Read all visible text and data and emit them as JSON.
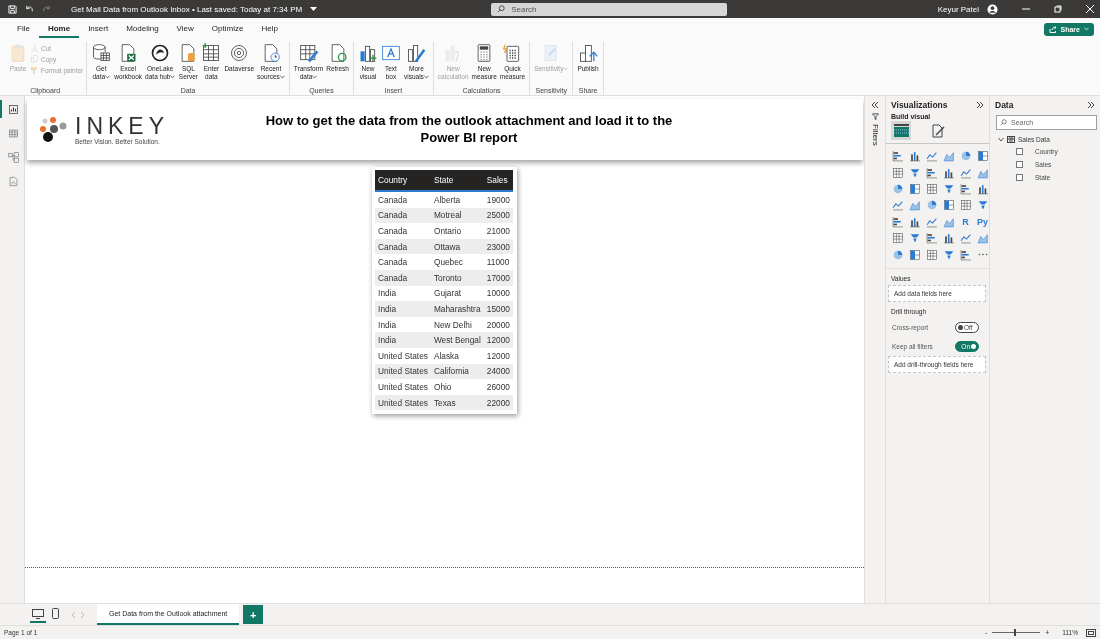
{
  "window": {
    "title": "Get Mail Data from Outlook Inbox • Last saved: Today at 7:34 PM",
    "search": {
      "placeholder": "Search"
    },
    "user": "Keyur Patel"
  },
  "menu_tabs": [
    {
      "label": "File",
      "selected": false
    },
    {
      "label": "Home",
      "selected": true
    },
    {
      "label": "Insert",
      "selected": false
    },
    {
      "label": "Modeling",
      "selected": false
    },
    {
      "label": "View",
      "selected": false
    },
    {
      "label": "Optimize",
      "selected": false
    },
    {
      "label": "Help",
      "selected": false
    }
  ],
  "share_button": "Share",
  "ribbon": [
    {
      "name": "Clipboard",
      "buttons": [
        {
          "kind": "large",
          "lines": [
            "Paste"
          ],
          "dropdown": false,
          "disabled": true
        },
        {
          "kind": "small",
          "lines": [
            "Cut"
          ],
          "dropdown": false,
          "disabled": true
        },
        {
          "kind": "small",
          "lines": [
            "Copy"
          ],
          "dropdown": false,
          "disabled": true
        },
        {
          "kind": "small",
          "lines": [
            "Format painter"
          ],
          "dropdown": false,
          "disabled": true
        }
      ]
    },
    {
      "name": "Data",
      "buttons": [
        {
          "kind": "large",
          "lines": [
            "Get",
            "data"
          ],
          "dropdown": true,
          "disabled": false
        },
        {
          "kind": "large",
          "lines": [
            "Excel",
            "workbook"
          ],
          "dropdown": false,
          "disabled": false
        },
        {
          "kind": "large",
          "lines": [
            "OneLake",
            "data hub"
          ],
          "dropdown": true,
          "disabled": false
        },
        {
          "kind": "large",
          "lines": [
            "SQL",
            "Server"
          ],
          "dropdown": false,
          "disabled": false
        },
        {
          "kind": "large",
          "lines": [
            "Enter",
            "data"
          ],
          "dropdown": false,
          "disabled": false
        },
        {
          "kind": "large",
          "lines": [
            "Dataverse"
          ],
          "dropdown": false,
          "disabled": false
        },
        {
          "kind": "large",
          "lines": [
            "Recent",
            "sources"
          ],
          "dropdown": true,
          "disabled": false
        }
      ]
    },
    {
      "name": "Queries",
      "buttons": [
        {
          "kind": "large",
          "lines": [
            "Transform",
            "data"
          ],
          "dropdown": true,
          "disabled": false
        },
        {
          "kind": "large",
          "lines": [
            "Refresh"
          ],
          "dropdown": false,
          "disabled": false
        }
      ]
    },
    {
      "name": "Insert",
      "buttons": [
        {
          "kind": "large",
          "lines": [
            "New",
            "visual"
          ],
          "dropdown": false,
          "disabled": false
        },
        {
          "kind": "large",
          "lines": [
            "Text",
            "box"
          ],
          "dropdown": false,
          "disabled": false
        },
        {
          "kind": "large",
          "lines": [
            "More",
            "visuals"
          ],
          "dropdown": true,
          "disabled": false
        }
      ]
    },
    {
      "name": "Calculations",
      "buttons": [
        {
          "kind": "large",
          "lines": [
            "New",
            "calculation"
          ],
          "dropdown": false,
          "disabled": true
        },
        {
          "kind": "large",
          "lines": [
            "New",
            "measure"
          ],
          "dropdown": false,
          "disabled": false
        },
        {
          "kind": "large",
          "lines": [
            "Quick",
            "measure"
          ],
          "dropdown": false,
          "disabled": false
        }
      ]
    },
    {
      "name": "Sensitivity",
      "buttons": [
        {
          "kind": "large",
          "lines": [
            "Sensitivity"
          ],
          "dropdown": true,
          "disabled": true
        }
      ]
    },
    {
      "name": "Share",
      "buttons": [
        {
          "kind": "large",
          "lines": [
            "Publish"
          ],
          "dropdown": false,
          "disabled": false
        }
      ]
    }
  ],
  "view_switcher": [
    {
      "selected": true
    },
    {
      "selected": false
    },
    {
      "selected": false
    },
    {
      "selected": false
    }
  ],
  "report": {
    "logo": {
      "wordmark": "INKEY",
      "tagline": "Better Vision. Better Solution."
    },
    "title": "How to get the data from the outlook attachment and load it to the Power BI report",
    "table": {
      "columns": [
        "Country",
        "State",
        "Sales"
      ],
      "rows": [
        [
          "Canada",
          "Alberta",
          "19000"
        ],
        [
          "Canada",
          "Motreal",
          "25000"
        ],
        [
          "Canada",
          "Ontario",
          "21000"
        ],
        [
          "Canada",
          "Ottawa",
          "23000"
        ],
        [
          "Canada",
          "Quebec",
          "11000"
        ],
        [
          "Canada",
          "Toronto",
          "17000"
        ],
        [
          "India",
          "Gujarat",
          "10000"
        ],
        [
          "India",
          "Maharashtra",
          "15000"
        ],
        [
          "India",
          "New Delhi",
          "20000"
        ],
        [
          "India",
          "West Bengal",
          "12000"
        ],
        [
          "United States",
          "Alaska",
          "12000"
        ],
        [
          "United States",
          "California",
          "24000"
        ],
        [
          "United States",
          "Ohio",
          "26000"
        ],
        [
          "United States",
          "Texas",
          "22000"
        ]
      ]
    }
  },
  "filters_pane": {
    "label": "Filters"
  },
  "visualizations": {
    "title": "Visualizations",
    "subtitle": "Build visual",
    "build_modes": [
      {
        "selected": true
      },
      {
        "selected": false
      }
    ],
    "gallery": [
      {
        "kind": "chart"
      },
      {
        "kind": "chart"
      },
      {
        "kind": "chart"
      },
      {
        "kind": "chart"
      },
      {
        "kind": "chart"
      },
      {
        "kind": "chart"
      },
      {
        "kind": "chart"
      },
      {
        "kind": "chart"
      },
      {
        "kind": "chart"
      },
      {
        "kind": "chart"
      },
      {
        "kind": "chart"
      },
      {
        "kind": "chart"
      },
      {
        "kind": "chart"
      },
      {
        "kind": "chart"
      },
      {
        "kind": "chart"
      },
      {
        "kind": "chart"
      },
      {
        "kind": "chart"
      },
      {
        "kind": "chart"
      },
      {
        "kind": "chart"
      },
      {
        "kind": "chart"
      },
      {
        "kind": "chart"
      },
      {
        "kind": "chart"
      },
      {
        "kind": "chart"
      },
      {
        "kind": "chart"
      },
      {
        "kind": "chart"
      },
      {
        "kind": "chart"
      },
      {
        "kind": "chart"
      },
      {
        "kind": "chart"
      },
      {
        "kind": "text",
        "label": "R"
      },
      {
        "kind": "text",
        "label": "Py"
      },
      {
        "kind": "chart"
      },
      {
        "kind": "chart"
      },
      {
        "kind": "chart"
      },
      {
        "kind": "chart"
      },
      {
        "kind": "chart"
      },
      {
        "kind": "chart"
      },
      {
        "kind": "chart"
      },
      {
        "kind": "chart"
      },
      {
        "kind": "chart"
      },
      {
        "kind": "chart"
      },
      {
        "kind": "chart"
      },
      {
        "kind": "more"
      }
    ],
    "values_label": "Values",
    "values_hint": "Add data fields here",
    "drill_title": "Drill through",
    "toggles": [
      {
        "label": "Cross-report",
        "on": false,
        "state_text": "Off"
      },
      {
        "label": "Keep all filters",
        "on": true,
        "state_text": "On"
      }
    ],
    "drill_hint": "Add drill-through fields here"
  },
  "data_pane": {
    "title": "Data",
    "search": {
      "placeholder": "Search"
    },
    "tree": [
      {
        "label": "Sales Data",
        "expanded": true,
        "children": [
          {
            "label": "Country",
            "checked": false
          },
          {
            "label": "Sales",
            "checked": false
          },
          {
            "label": "State",
            "checked": false
          }
        ]
      }
    ]
  },
  "page_bar": {
    "views": [
      {
        "selected": true
      },
      {
        "selected": false
      }
    ],
    "pages": [
      {
        "label": "Get Data from the Outlook attachment",
        "selected": true
      }
    ],
    "add_label": "+"
  },
  "status_bar": {
    "page": "Page 1 of 1",
    "zoom": {
      "minus": "-",
      "plus": "+",
      "level": 0.45,
      "reading": "111%"
    }
  }
}
